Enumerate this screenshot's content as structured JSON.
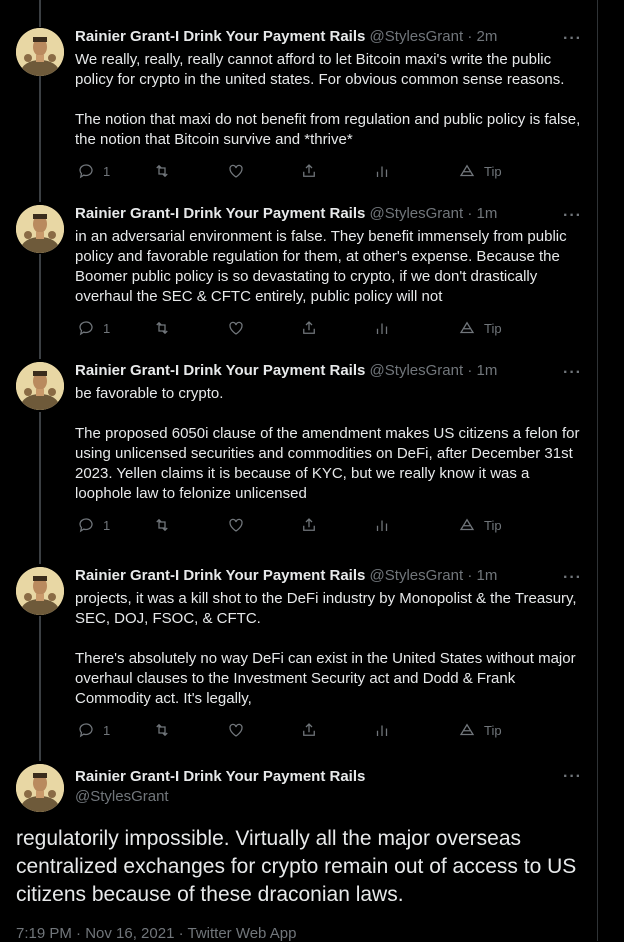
{
  "tweets": [
    {
      "name": "Rainier Grant-I Drink Your Payment Rails",
      "handle": "@StylesGrant",
      "sep": "·",
      "time": "2m",
      "paragraphs": [
        "We really, really, really cannot afford to let Bitcoin maxi's write the public policy for crypto in the united states. For obvious common sense reasons.",
        "The notion that maxi do not benefit from regulation and public policy is false, the notion that Bitcoin survive and *thrive*"
      ],
      "reply_count": "1",
      "tip_label": "Tip"
    },
    {
      "name": "Rainier Grant-I Drink Your Payment Rails",
      "handle": "@StylesGrant",
      "sep": "·",
      "time": "1m",
      "paragraphs": [
        "in an adversarial environment is false. They benefit immensely from public policy and favorable regulation for them, at other's expense. Because the Boomer public policy is so devastating to crypto, if we don't drastically overhaul the SEC & CFTC entirely, public policy will not"
      ],
      "reply_count": "1",
      "tip_label": "Tip"
    },
    {
      "name": "Rainier Grant-I Drink Your Payment Rails",
      "handle": "@StylesGrant",
      "sep": "·",
      "time": "1m",
      "paragraphs": [
        "be favorable to crypto.",
        "The proposed 6050i clause of the amendment makes US citizens a felon for using unlicensed securities and commodities on DeFi, after December 31st 2023. Yellen claims it is because of KYC, but we really know it was a loophole law to felonize unlicensed"
      ],
      "reply_count": "1",
      "tip_label": "Tip"
    },
    {
      "name": "Rainier Grant-I Drink Your Payment Rails",
      "handle": "@StylesGrant",
      "sep": "·",
      "time": "1m",
      "paragraphs": [
        "projects, it was a kill shot to the DeFi industry by Monopolist & the Treasury, SEC, DOJ, FSOC, & CFTC.",
        "There's absolutely no way DeFi can exist in the United States without major overhaul clauses to the Investment Security act and Dodd & Frank Commodity act. It's legally,"
      ],
      "reply_count": "1",
      "tip_label": "Tip"
    }
  ],
  "main_tweet": {
    "name": "Rainier Grant-I Drink Your Payment Rails",
    "handle": "@StylesGrant",
    "text": "regulatorily impossible. Virtually all the major overseas centralized exchanges for crypto remain out of access to US citizens because of these draconian laws.",
    "meta": "7:19 PM · Nov 16, 2021 · Twitter Web App"
  },
  "more_glyph": "···",
  "icons": [
    "reply-icon",
    "retweet-icon",
    "like-icon",
    "share-icon",
    "analytics-icon",
    "tip-icon",
    "more-icon"
  ],
  "colors": {
    "background": "#000000",
    "text": "#e7e9ea",
    "muted": "#71767b",
    "thread_line": "#3b3f43"
  }
}
